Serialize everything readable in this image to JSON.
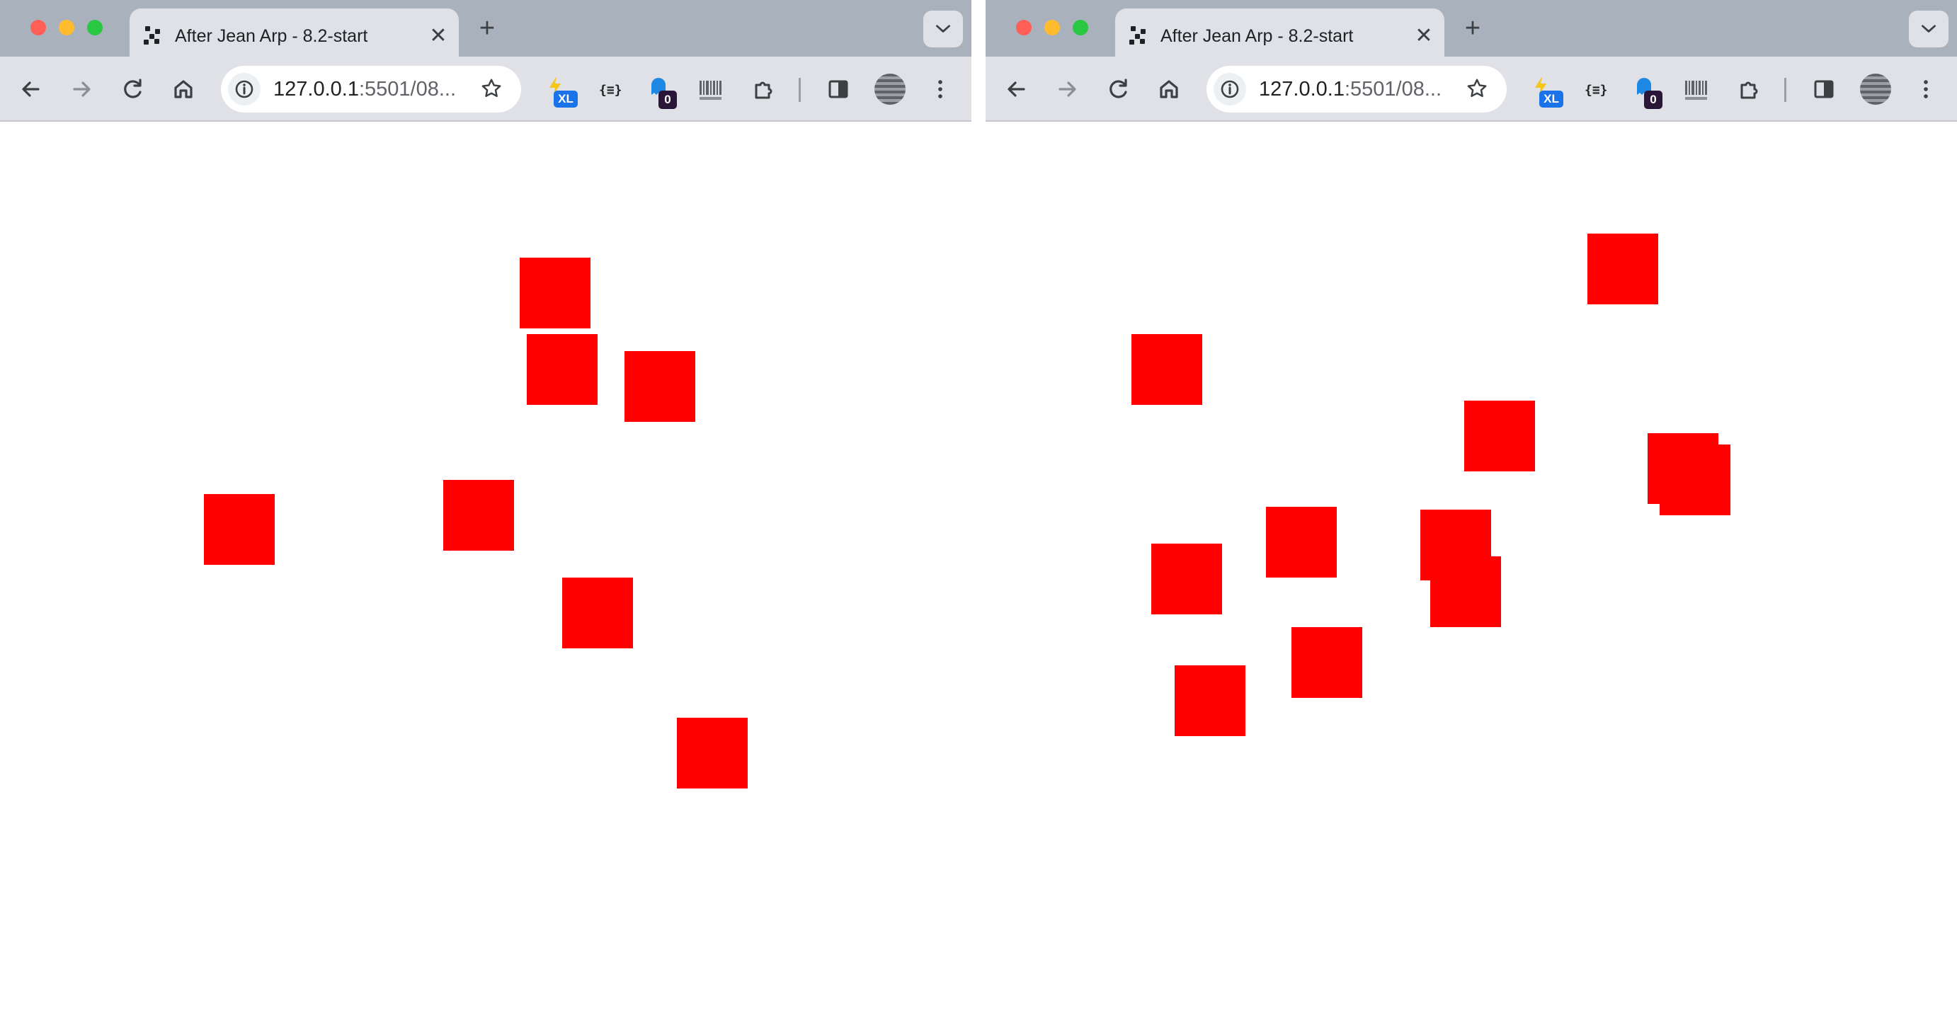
{
  "windows": [
    {
      "tab_title": "After Jean Arp - 8.2-start",
      "new_tab_label": "+",
      "tab_close_label": "✕",
      "url_host": "127.0.0.1",
      "url_rest": ":5501/08...",
      "extensions": {
        "xl_badge": "XL",
        "json_label": "{≡}",
        "counter_badge": "0"
      }
    },
    {
      "tab_title": "After Jean Arp - 8.2-start",
      "new_tab_label": "+",
      "tab_close_label": "✕",
      "url_host": "127.0.0.1",
      "url_rest": ":5501/08...",
      "extensions": {
        "xl_badge": "XL",
        "json_label": "{≡}",
        "counter_badge": "0"
      }
    }
  ],
  "icons": {
    "back": "back-arrow-icon",
    "forward": "forward-arrow-icon",
    "reload": "reload-icon",
    "home": "home-icon",
    "site_info": "info-icon",
    "bookmark": "star-icon",
    "extensions": "puzzle-icon",
    "side_panel": "side-panel-icon",
    "profile": "avatar-icon",
    "menu": "kebab-menu-icon",
    "tab_search": "chevron-down-icon"
  },
  "colors": {
    "square": "#ff0000",
    "titlebar": "#a9b1bd",
    "toolbar": "#dfe1e6",
    "close": "#ff5f57",
    "minimize": "#febc2e",
    "maximize": "#28c840"
  }
}
